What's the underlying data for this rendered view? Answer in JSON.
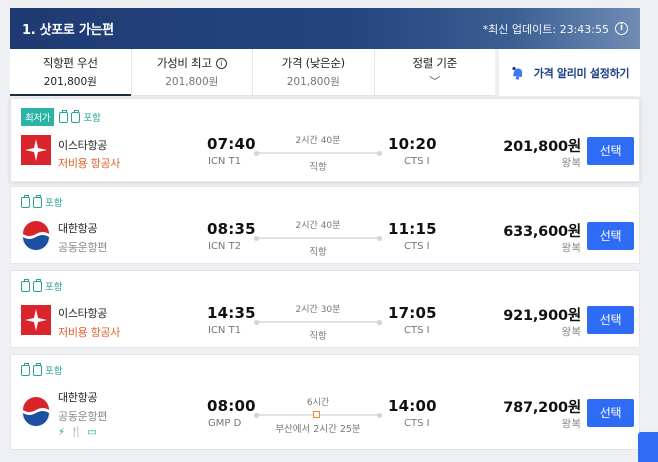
{
  "header": {
    "title": "1. 삿포로 가는편",
    "updated": "*최신 업데이트: 23:43:55",
    "info": "i"
  },
  "sort_tabs": [
    {
      "label": "직항편 우선",
      "price": "201,800원",
      "active": true
    },
    {
      "label": "가성비 최고",
      "price": "201,800원",
      "icon": "info-icon"
    },
    {
      "label": "가격 (낮은순)",
      "price": "201,800원"
    },
    {
      "label": "정렬 기준",
      "chevron": "﹀"
    }
  ],
  "alert": {
    "label": "가격 알리미 설정하기",
    "icon": "bell-icon"
  },
  "flights": [
    {
      "tags": {
        "lowest": "최저가",
        "bag": "포함"
      },
      "airline": "이스타항공",
      "sub": "저비용 항공사",
      "sub_type": "lcc",
      "logo": "eastar",
      "dep_time": "07:40",
      "dep_ap": "ICN T1",
      "arr_time": "10:20",
      "arr_ap": "CTS I",
      "duration": "2시간 40분",
      "route_type": "직항",
      "price": "201,800원",
      "roundtrip": "왕복",
      "button": "선택"
    },
    {
      "tags": {
        "bag": "포함"
      },
      "airline": "대한항공",
      "sub": "공동운항편",
      "sub_type": "code",
      "logo": "korean",
      "dep_time": "08:35",
      "dep_ap": "ICN T2",
      "arr_time": "11:15",
      "arr_ap": "CTS I",
      "duration": "2시간 40분",
      "route_type": "직항",
      "price": "633,600원",
      "roundtrip": "왕복",
      "button": "선택"
    },
    {
      "tags": {
        "bag": "포함"
      },
      "airline": "이스타항공",
      "sub": "저비용 항공사",
      "sub_type": "lcc",
      "logo": "eastar",
      "dep_time": "14:35",
      "dep_ap": "ICN T1",
      "arr_time": "17:05",
      "arr_ap": "CTS I",
      "duration": "2시간 30분",
      "route_type": "직항",
      "price": "921,900원",
      "roundtrip": "왕복",
      "button": "선택"
    },
    {
      "tags": {
        "bag": "포함"
      },
      "airline": "대한항공",
      "sub": "공동운항편",
      "sub_type": "code",
      "logo": "korean",
      "dep_time": "08:00",
      "dep_ap": "GMP D",
      "arr_time": "14:00",
      "arr_ap": "CTS I",
      "duration": "6시간",
      "route_type": "부산에서 2시간 25분",
      "price": "787,200원",
      "roundtrip": "왕복",
      "button": "선택",
      "amenities": [
        "⚡",
        "🍴",
        "▭"
      ]
    }
  ],
  "colors": {
    "accent": "#2e6cf6",
    "header": "#1f3a73",
    "lcc": "#e0602c",
    "teal": "#2bb3a6"
  }
}
